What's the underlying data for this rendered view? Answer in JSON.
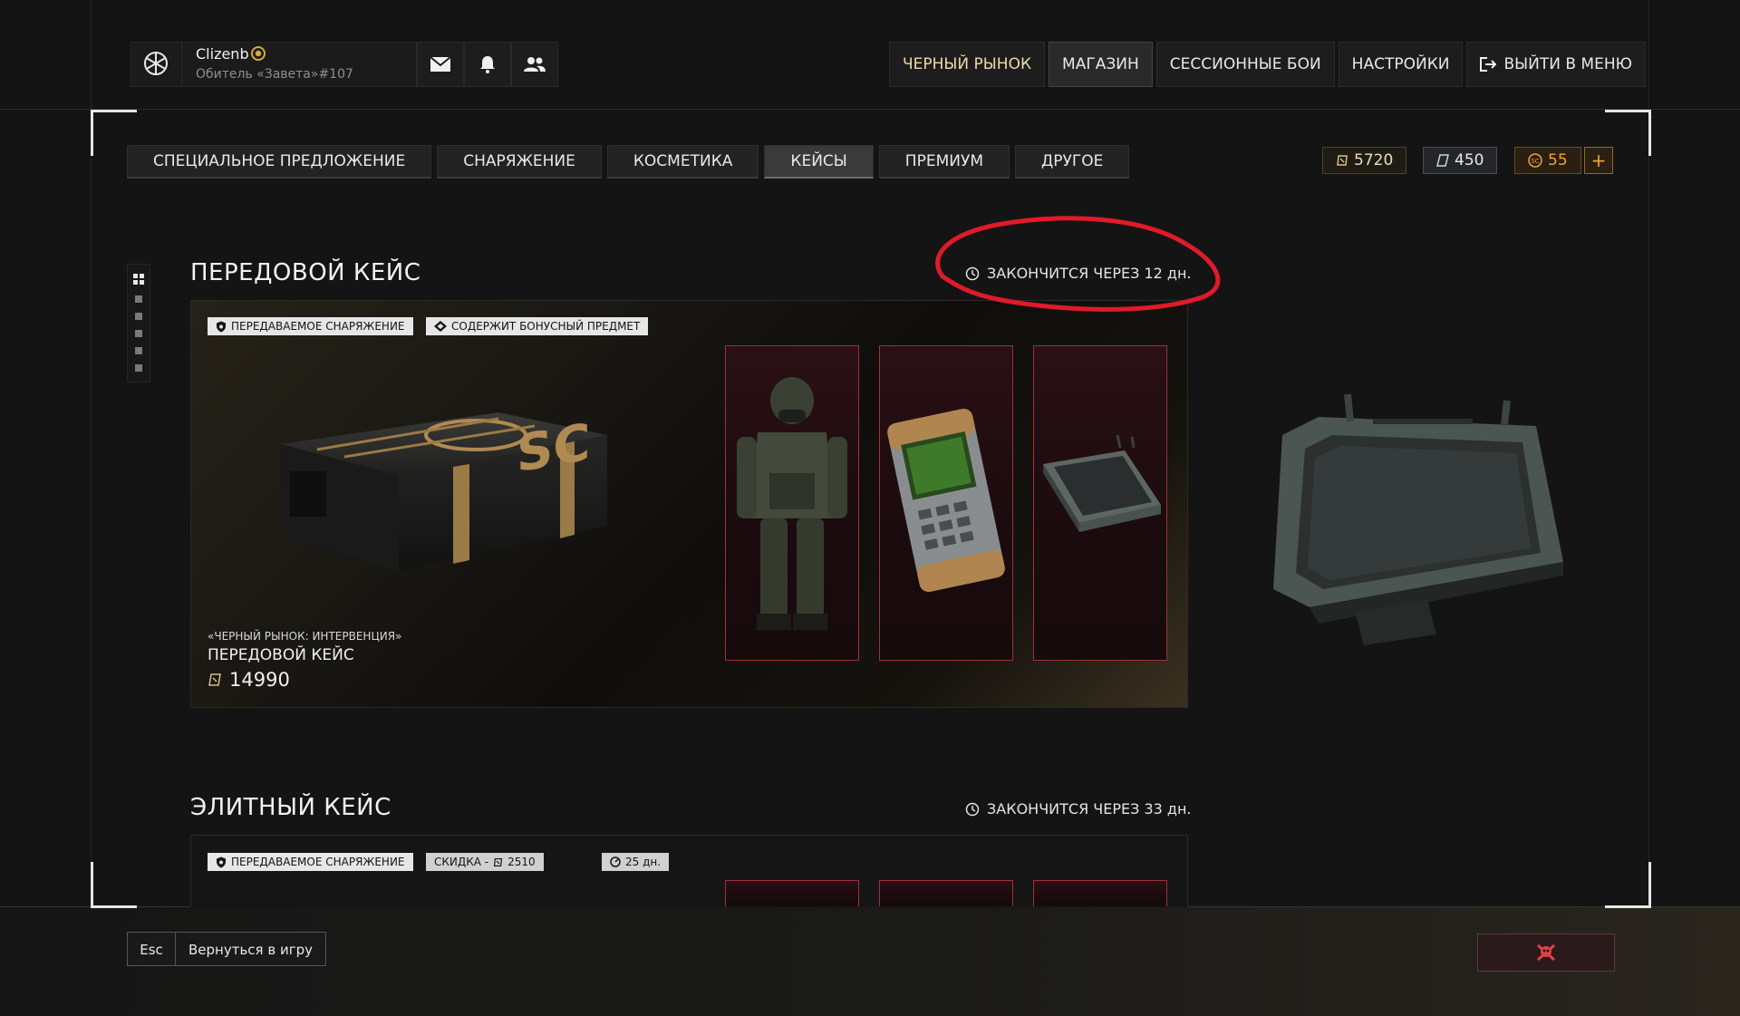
{
  "colors": {
    "accent_gold": "#d6a93a",
    "slot_border": "#a03038",
    "annotation_red": "#e01a2a"
  },
  "user": {
    "name": "Clizenb",
    "title": "Обитель «Завета»#107",
    "logo_icon": "snowflake-emblem-icon",
    "badge_icon": "sun-badge-icon"
  },
  "header_icons": [
    {
      "name": "mail-icon"
    },
    {
      "name": "bell-icon"
    },
    {
      "name": "friends-icon"
    }
  ],
  "nav": {
    "black_market": "ЧЕРНЫЙ РЫНОК",
    "shop": "МАГАЗИН",
    "session_battles": "СЕССИОННЫЕ БОИ",
    "settings": "НАСТРОЙКИ",
    "exit": "ВЫЙТИ В МЕНЮ",
    "active": "МАГАЗИН"
  },
  "tabs": [
    {
      "label": "СПЕЦИАЛЬНОЕ ПРЕДЛОЖЕНИЕ",
      "active": false
    },
    {
      "label": "СНАРЯЖЕНИЕ",
      "active": false
    },
    {
      "label": "КОСМЕТИКА",
      "active": false
    },
    {
      "label": "КЕЙСЫ",
      "active": true
    },
    {
      "label": "ПРЕМИУМ",
      "active": false
    },
    {
      "label": "ДРУГОЕ",
      "active": false
    }
  ],
  "currency": {
    "cash": "5720",
    "tickets": "450",
    "sc": "55",
    "add_label": "+"
  },
  "section1": {
    "title": "ПЕРЕДОВОЙ КЕЙС",
    "timer": "ЗАКОНЧИТСЯ ЧЕРЕЗ 12 дн.",
    "badge_transfer": "ПЕРЕДАВАЕМОЕ СНАРЯЖЕНИЕ",
    "badge_bonus": "СОДЕРЖИТ БОНУСНЫЙ ПРЕДМЕТ",
    "case_logo": "SC",
    "case_subtitle": "«ЧЕРНЫЙ РЫНОК: ИНТЕРВЕНЦИЯ»",
    "case_name": "ПЕРЕДОВОЙ КЕЙС",
    "price": "14990",
    "items": [
      "armored-soldier-item",
      "scanner-device-item",
      "tablet-item"
    ],
    "preview": "tablet-preview-item"
  },
  "section2": {
    "title": "ЭЛИТНЫЙ КЕЙС",
    "timer": "ЗАКОНЧИТСЯ ЧЕРЕЗ 33 дн.",
    "badge_transfer": "ПЕРЕДАВАЕМОЕ СНАРЯЖЕНИЕ",
    "badge_discount": "СКИДКА - ",
    "discount_value": "2510",
    "badge_time": "25 дн."
  },
  "footer": {
    "esc_key": "Esc",
    "esc_label": "Вернуться в игру",
    "report_icon": "skull-crossbones-icon"
  }
}
